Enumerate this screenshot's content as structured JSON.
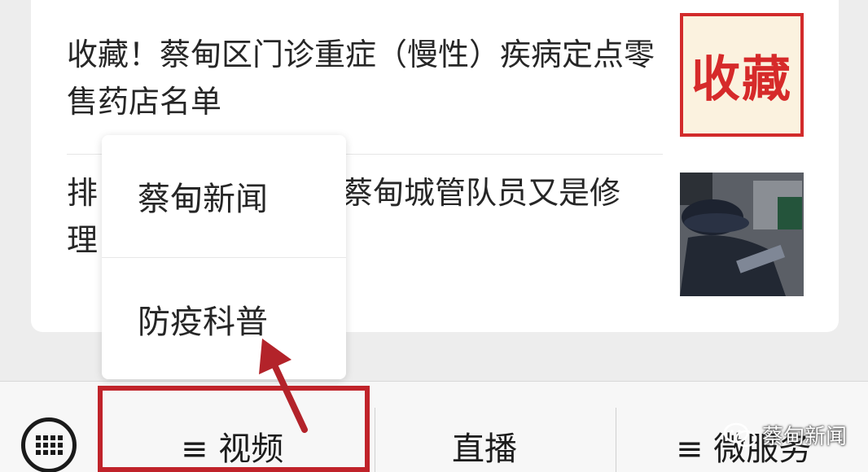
{
  "articles": [
    {
      "title": "收藏！蔡甸区门诊重症（慢性）疾病定点零售药店名单",
      "thumb_text": "收藏"
    },
    {
      "title": "排查……蔡甸城管队员又是修理……",
      "title_visible_left": "排",
      "title_visible_right": "蔡甸城管队员又是修",
      "title_line2": "理"
    }
  ],
  "menu": {
    "items": [
      {
        "label": "蔡甸新闻"
      },
      {
        "label": "防疫科普"
      }
    ]
  },
  "bottom_bar": {
    "tabs": [
      {
        "label": "≡ 视频"
      },
      {
        "label": "直播"
      },
      {
        "label": "≡ 微服务"
      }
    ]
  },
  "watermark": {
    "text": "蔡甸新闻"
  },
  "colors": {
    "highlight": "#c0232a",
    "accent_red": "#d62a2a"
  }
}
